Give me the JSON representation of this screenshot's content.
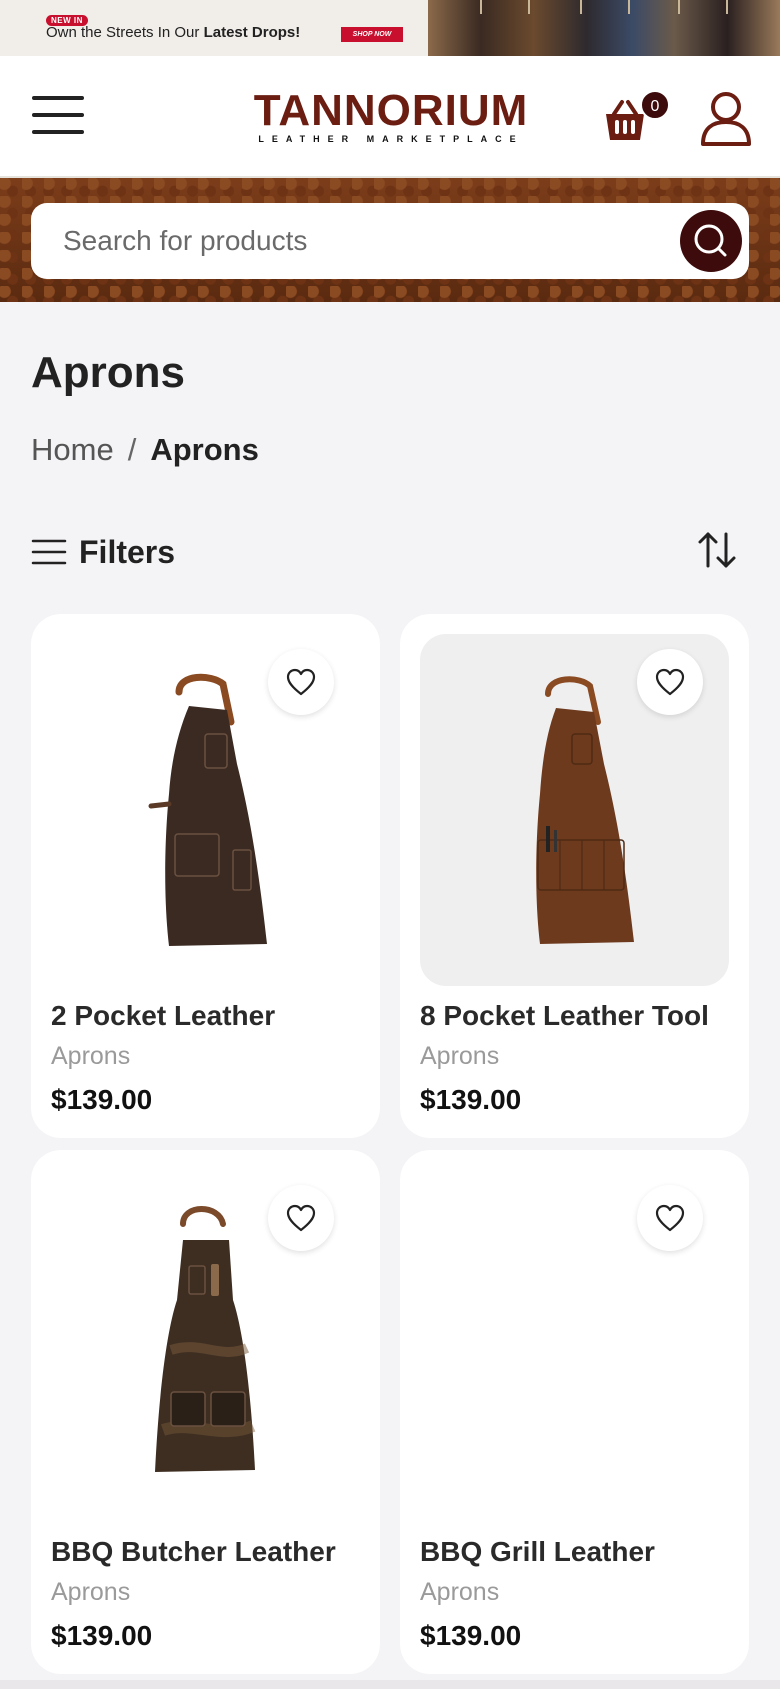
{
  "promo": {
    "badge": "NEW IN",
    "text_prefix": "Own the Streets In Our ",
    "text_bold": "Latest Drops!",
    "cta": "SHOP NOW"
  },
  "header": {
    "logo_main": "TANNORIUM",
    "logo_sub": "LEATHER MARKETPLACE",
    "cart_count": "0",
    "icons": {
      "menu": "hamburger-menu-icon",
      "cart": "shopping-basket-icon",
      "account": "user-icon"
    }
  },
  "search": {
    "placeholder": "Search for products",
    "value": "",
    "icon": "search-icon"
  },
  "page": {
    "title": "Aprons",
    "breadcrumb": {
      "home": "Home",
      "separator": "/",
      "current": "Aprons"
    },
    "filters_label": "Filters",
    "sort_icon": "sort-arrows-icon"
  },
  "products": [
    {
      "name": "2 Pocket Leather",
      "category": "Aprons",
      "price": "$139.00",
      "image": "dark-brown-leather-apron"
    },
    {
      "name": "8 Pocket Leather Tool",
      "category": "Aprons",
      "price": "$139.00",
      "image": "brown-tool-leather-apron"
    },
    {
      "name": "BBQ Butcher Leather",
      "category": "Aprons",
      "price": "$139.00",
      "image": "distressed-butcher-apron"
    },
    {
      "name": "BBQ Grill Leather",
      "category": "Aprons",
      "price": "$139.00",
      "image": ""
    }
  ],
  "colors": {
    "brand": "#6b1d12",
    "accent_dark": "#3d0b0b",
    "promo_red": "#c8102e",
    "page_bg": "#f4f3f5"
  }
}
